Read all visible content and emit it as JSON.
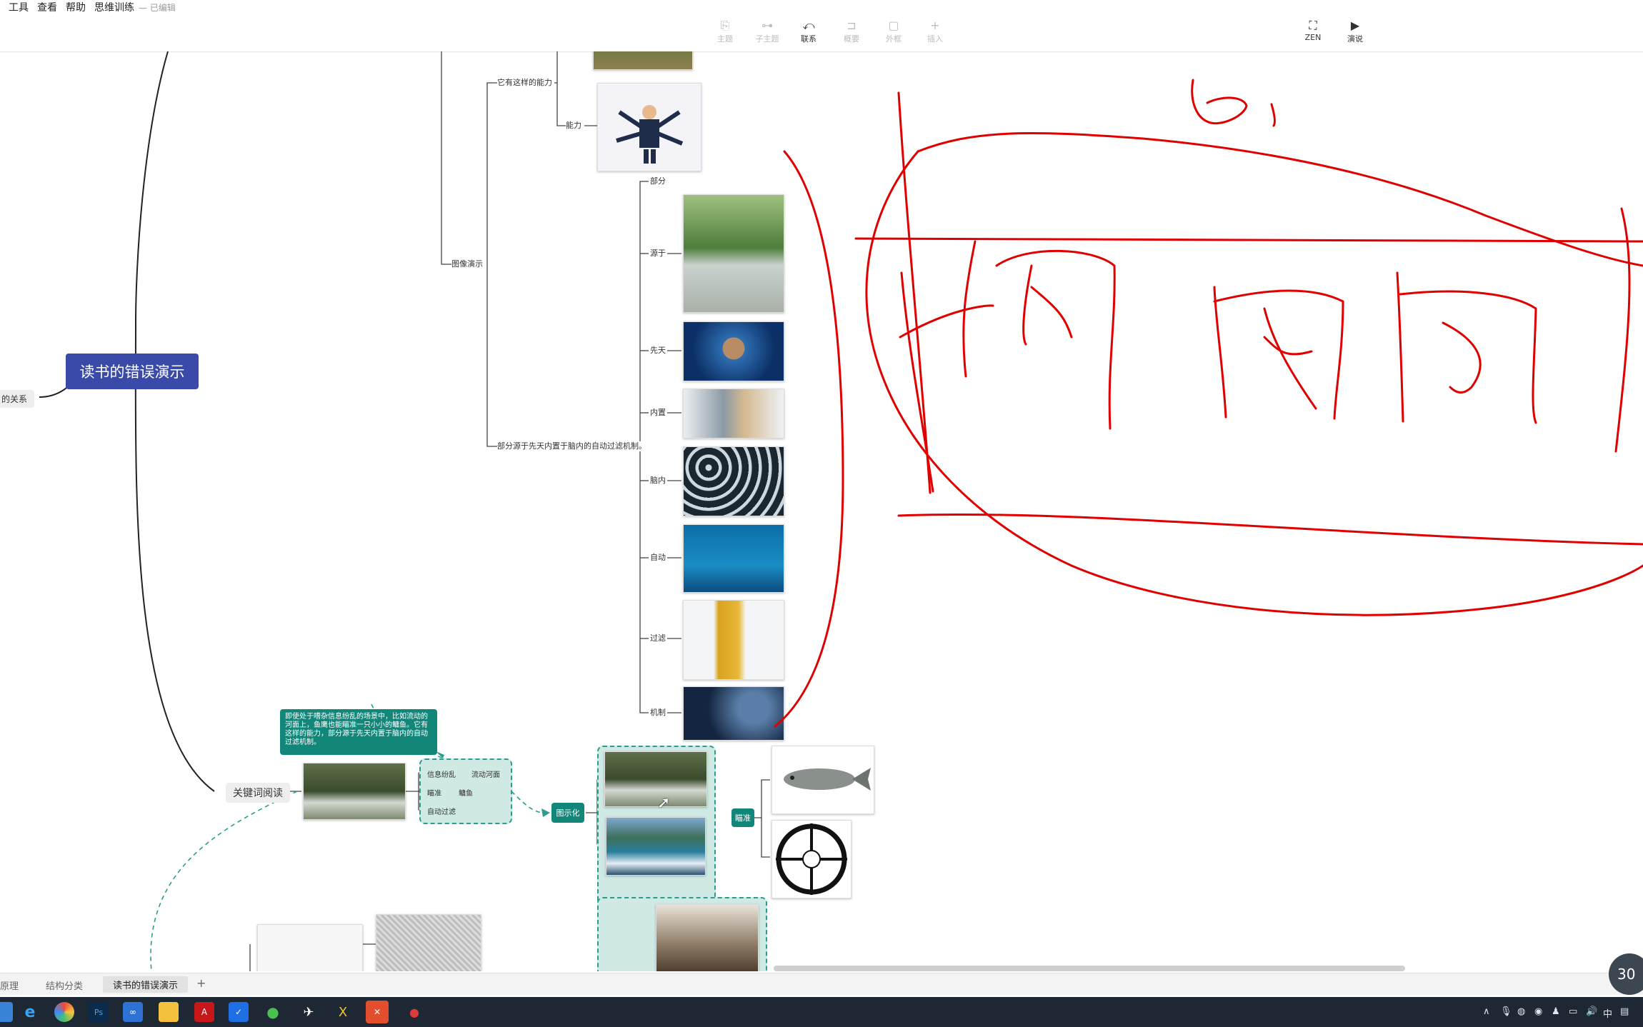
{
  "menu": {
    "items": [
      "工具",
      "查看",
      "帮助",
      "思维训练"
    ],
    "status": "— 已编辑"
  },
  "toolbar": {
    "items": [
      {
        "label": "主题",
        "icon": "topic-icon",
        "enabled": false
      },
      {
        "label": "子主题",
        "icon": "subtopic-icon",
        "enabled": false
      },
      {
        "label": "联系",
        "icon": "relationship-icon",
        "enabled": true
      },
      {
        "label": "概要",
        "icon": "summary-icon",
        "enabled": false
      },
      {
        "label": "外框",
        "icon": "boundary-icon",
        "enabled": false
      },
      {
        "label": "插入",
        "icon": "plus-icon",
        "enabled": false
      }
    ],
    "right": [
      {
        "label": "ZEN",
        "icon": "fullscreen-icon"
      },
      {
        "label": "演说",
        "icon": "play-icon"
      }
    ]
  },
  "mindmap": {
    "root": "读书的错误演示",
    "left_partial": "的关系",
    "ability_branch": "它有这样的能力",
    "ability_child": "能力",
    "image_demo": "图像演示",
    "long_topic": "部分源于先天内置于脑内的自动过滤机制。",
    "words": [
      "部分",
      "源于",
      "先天",
      "内置",
      "脑内",
      "自动",
      "过滤",
      "机制"
    ],
    "keyword_topic": "关键词阅读",
    "note_text": "即使处于嘈杂信息纷乱的场景中，比如流动的河面上，鱼鹰也能瞄准一只小小的鳙鱼。它有这样的能力，部分源于先天内置于脑内的自动过滤机制。",
    "box_items": [
      "信息纷乱",
      "流动河面",
      "瞄准",
      "鳙鱼",
      "自动过滤"
    ],
    "visualize": "图示化",
    "aim": "瞄准"
  },
  "sheets": {
    "tabs": [
      "原理",
      "结构分类",
      "读书的错误演示"
    ],
    "active": "读书的错误演示",
    "add": "+"
  },
  "zoom": "30",
  "taskbar": {
    "apps": [
      "ie-icon",
      "colorful-app-icon",
      "photoshop-icon",
      "app-icon",
      "folder-icon",
      "acrobat-icon",
      "shield-icon",
      "wechat-icon",
      "feishu-icon",
      "xmind-icon",
      "office-icon",
      "record-icon"
    ],
    "tray_ime": "中"
  },
  "colors": {
    "root": "#3a4aa8",
    "teal": "#13867a",
    "ink": "#e00000"
  }
}
